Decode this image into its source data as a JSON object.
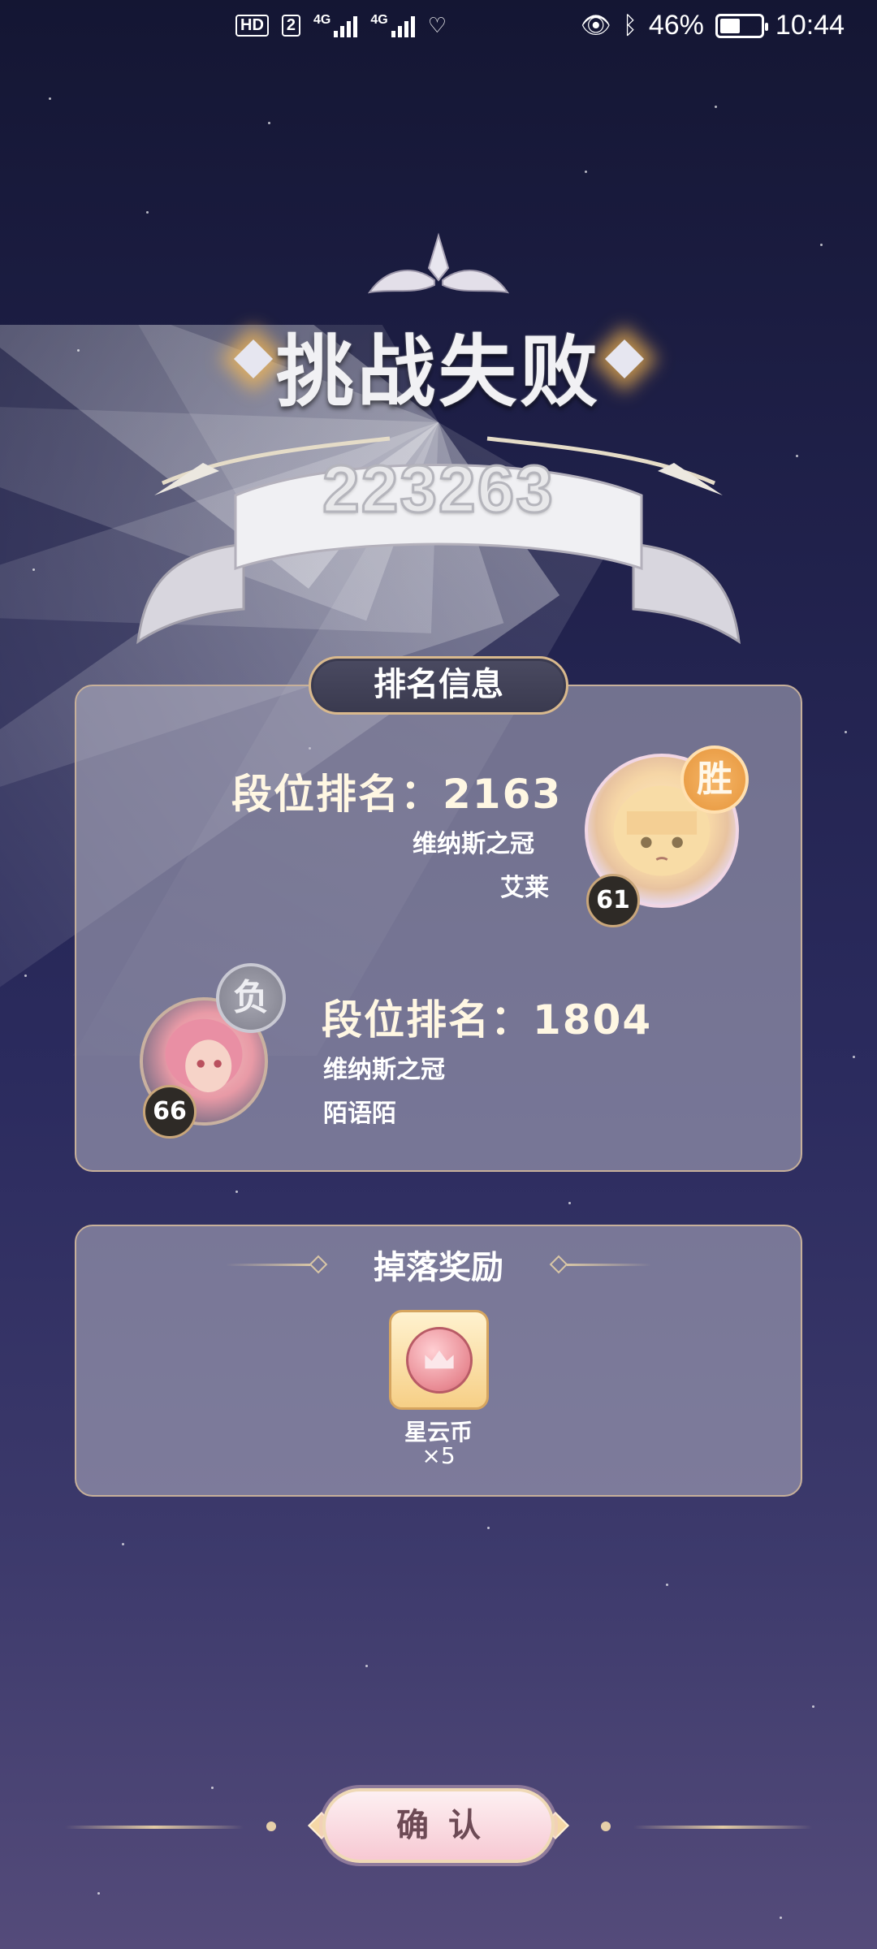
{
  "status_bar": {
    "network_hd": "HD",
    "sim_slot": "2",
    "net_4g_1": "4G",
    "net_4g_2": "4G",
    "battery_percent": "46%",
    "time": "10:44"
  },
  "result": {
    "title": "挑战失败",
    "score": "223263"
  },
  "rank_info": {
    "tab_label": "排名信息",
    "winner": {
      "rank_label": "段位排名：2163",
      "tier": "维纳斯之冠",
      "name": "艾莱",
      "level": "61",
      "seal": "胜"
    },
    "challenger": {
      "rank_label": "段位排名：1804",
      "tier": "维纳斯之冠",
      "name": "陌语陌",
      "level": "66",
      "seal": "负"
    }
  },
  "rewards": {
    "title": "掉落奖励",
    "items": [
      {
        "name": "星云币",
        "quantity": "×5",
        "icon": "nebula-coin-icon"
      }
    ]
  },
  "confirm_button": {
    "label": "确认"
  },
  "colors": {
    "panel_border": "#c7b09a",
    "tab_border": "#d9b98d",
    "confirm_bg": "#f7c9d3",
    "win_seal": "#e89a3c",
    "lose_seal": "#8f8f9a"
  }
}
